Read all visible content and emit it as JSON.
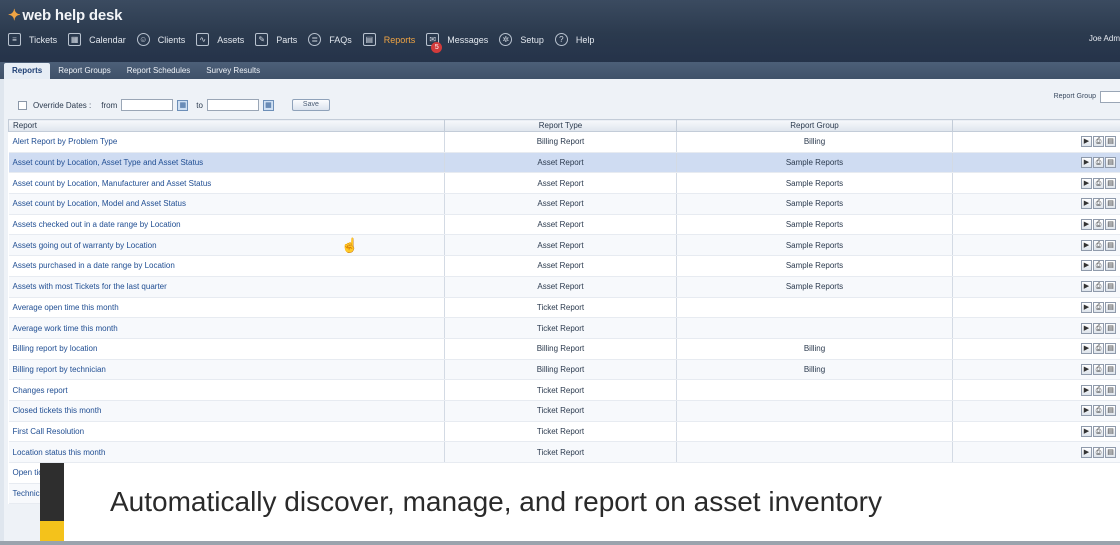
{
  "app": {
    "logo": "web help desk",
    "user": "Joe Adm"
  },
  "nav": {
    "items": [
      {
        "label": "Tickets",
        "icon": "≡"
      },
      {
        "label": "Calendar",
        "icon": "▦"
      },
      {
        "label": "Clients",
        "icon": "☺"
      },
      {
        "label": "Assets",
        "icon": "∿"
      },
      {
        "label": "Parts",
        "icon": "✎"
      },
      {
        "label": "FAQs",
        "icon": "≣"
      },
      {
        "label": "Reports",
        "icon": "▤"
      },
      {
        "label": "Messages",
        "icon": "✉",
        "badge": "5"
      },
      {
        "label": "Setup",
        "icon": "✲"
      },
      {
        "label": "Help",
        "icon": "?"
      }
    ],
    "active": "Reports",
    "active_color": "#f0a443"
  },
  "subtabs": [
    "Reports",
    "Report Groups",
    "Report Schedules",
    "Survey Results"
  ],
  "filter": {
    "override_label": "Override Dates :",
    "from_label": "from",
    "to_label": "to",
    "save_label": "Save",
    "report_group_label": "Report Group"
  },
  "table": {
    "headers": {
      "report": "Report",
      "type": "Report Type",
      "group": "Report Group"
    },
    "rows": [
      {
        "name": "Alert Report by Problem Type",
        "type": "Billing Report",
        "group": "Billing"
      },
      {
        "name": "Asset count by Location, Asset Type and Asset Status",
        "type": "Asset Report",
        "group": "Sample Reports"
      },
      {
        "name": "Asset count by Location, Manufacturer and Asset Status",
        "type": "Asset Report",
        "group": "Sample Reports"
      },
      {
        "name": "Asset count by Location, Model and Asset Status",
        "type": "Asset Report",
        "group": "Sample Reports"
      },
      {
        "name": "Assets checked out in a date range by Location",
        "type": "Asset Report",
        "group": "Sample Reports"
      },
      {
        "name": "Assets going out of warranty by Location",
        "type": "Asset Report",
        "group": "Sample Reports"
      },
      {
        "name": "Assets purchased in a date range by Location",
        "type": "Asset Report",
        "group": "Sample Reports"
      },
      {
        "name": "Assets with most Tickets for the last quarter",
        "type": "Asset Report",
        "group": "Sample Reports"
      },
      {
        "name": "Average open time this month",
        "type": "Ticket Report",
        "group": ""
      },
      {
        "name": "Average work time this month",
        "type": "Ticket Report",
        "group": ""
      },
      {
        "name": "Billing report by location",
        "type": "Billing Report",
        "group": "Billing"
      },
      {
        "name": "Billing report by technician",
        "type": "Billing Report",
        "group": "Billing"
      },
      {
        "name": "Changes report",
        "type": "Ticket Report",
        "group": ""
      },
      {
        "name": "Closed tickets this month",
        "type": "Ticket Report",
        "group": ""
      },
      {
        "name": "First Call Resolution",
        "type": "Ticket Report",
        "group": ""
      },
      {
        "name": "Location status this month",
        "type": "Ticket Report",
        "group": ""
      },
      {
        "name": "Open tic",
        "type": "",
        "group": ""
      },
      {
        "name": "Technici",
        "type": "",
        "group": ""
      }
    ],
    "selected_row": 1
  },
  "caption": {
    "text": "Automatically discover, manage, and report on asset inventory"
  }
}
